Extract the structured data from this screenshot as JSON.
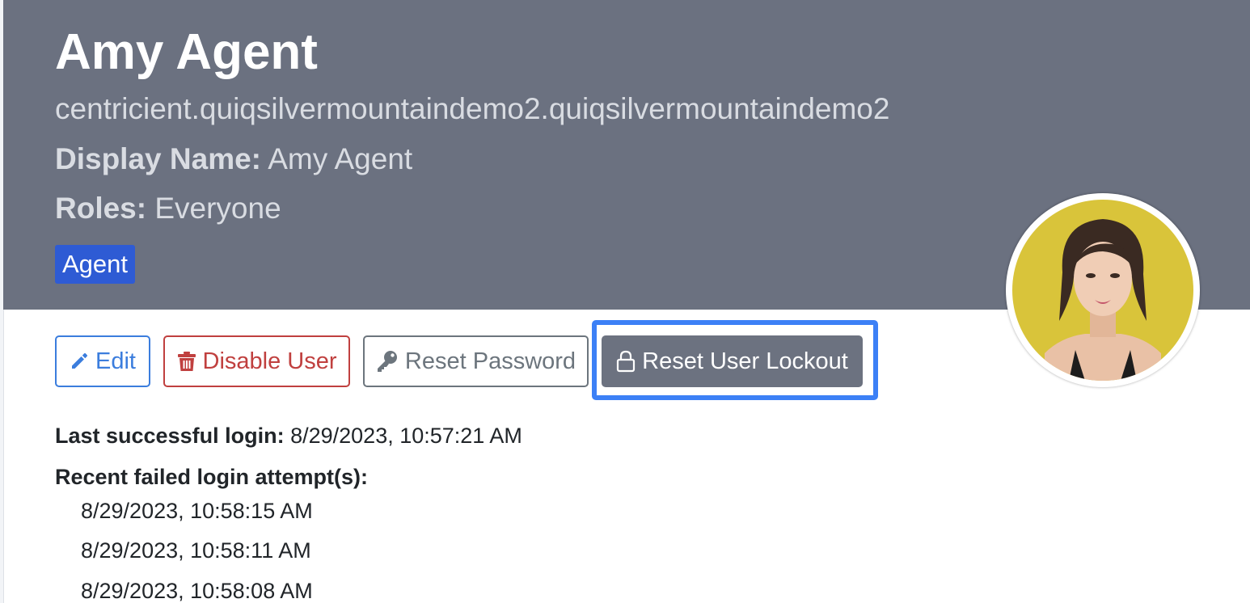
{
  "profile": {
    "name": "Amy Agent",
    "username": "centricient.quiqsilvermountaindemo2.quiqsilvermountaindemo2",
    "display_name_label": "Display Name:",
    "display_name_value": "Amy Agent",
    "roles_label": "Roles:",
    "roles_value": "Everyone",
    "type_badge": "Agent",
    "header_color": "#6b7180",
    "badge_color": "#2e5bd4"
  },
  "actions": {
    "edit": {
      "label": "Edit",
      "icon": "pencil-icon",
      "color": "#3b7ddd"
    },
    "disable": {
      "label": "Disable User",
      "icon": "trash-icon",
      "color": "#c0403f"
    },
    "reset_password": {
      "label": "Reset Password",
      "icon": "key-icon",
      "color": "#6c757d"
    },
    "reset_lockout": {
      "label": "Reset User Lockout",
      "icon": "lock-icon",
      "color": "#6c7280",
      "focused": true
    }
  },
  "login": {
    "last_success_label": "Last successful login:",
    "last_success_value": "8/29/2023, 10:57:21 AM",
    "failed_label": "Recent failed login attempt(s):",
    "failed_attempts": [
      "8/29/2023, 10:58:15 AM",
      "8/29/2023, 10:58:11 AM",
      "8/29/2023, 10:58:08 AM"
    ]
  }
}
